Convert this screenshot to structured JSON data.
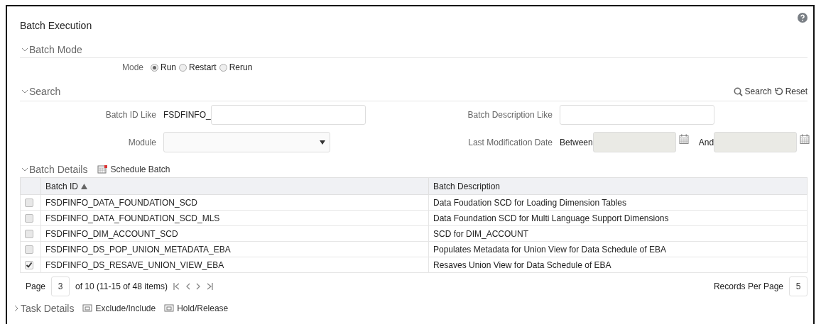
{
  "title": "Batch Execution",
  "batch_mode": {
    "heading": "Batch Mode",
    "expanded": true,
    "label": "Mode",
    "options": [
      {
        "label": "Run",
        "selected": true
      },
      {
        "label": "Restart",
        "selected": false
      },
      {
        "label": "Rerun",
        "selected": false
      }
    ]
  },
  "search": {
    "heading": "Search",
    "expanded": true,
    "actions": [
      {
        "kind": "search",
        "label": "Search"
      },
      {
        "kind": "reset",
        "label": "Reset"
      }
    ],
    "batch_id_label": "Batch ID Like",
    "batch_id_prefix": "FSDFINFO_",
    "description_label": "Batch Description Like",
    "module_label": "Module",
    "date_label": "Last Modification Date",
    "between_label": "Between",
    "and_label": "And"
  },
  "batch_details": {
    "heading": "Batch Details",
    "expanded": true,
    "action": "Schedule Batch",
    "columns": [
      "Batch ID",
      "Batch Description"
    ],
    "rows": [
      {
        "id": "FSDFINFO_DATA_FOUNDATION_SCD",
        "description": "Data Foudation SCD for Loading Dimension Tables",
        "checked": false
      },
      {
        "id": "FSDFINFO_DATA_FOUNDATION_SCD_MLS",
        "description": "Data Foundation SCD for Multi Language Support Dimensions",
        "checked": false
      },
      {
        "id": "FSDFINFO_DIM_ACCOUNT_SCD",
        "description": "SCD for DIM_ACCOUNT",
        "checked": false
      },
      {
        "id": "FSDFINFO_DS_POP_UNION_METADATA_EBA",
        "description": "Populates Metadata for Union View for Data Schedule of EBA",
        "checked": false
      },
      {
        "id": "FSDFINFO_DS_RESAVE_UNION_VIEW_EBA",
        "description": "Resaves Union View for Data Schedule of EBA",
        "checked": true
      }
    ],
    "pagination": {
      "page_label": "Page",
      "page": "3",
      "summary": "of 10 (11-15 of 48 items)",
      "records_label": "Records Per Page",
      "records": "5"
    }
  },
  "task_details": {
    "heading": "Task Details",
    "expanded": false,
    "actions": [
      "Exclude/Include",
      "Hold/Release"
    ]
  }
}
